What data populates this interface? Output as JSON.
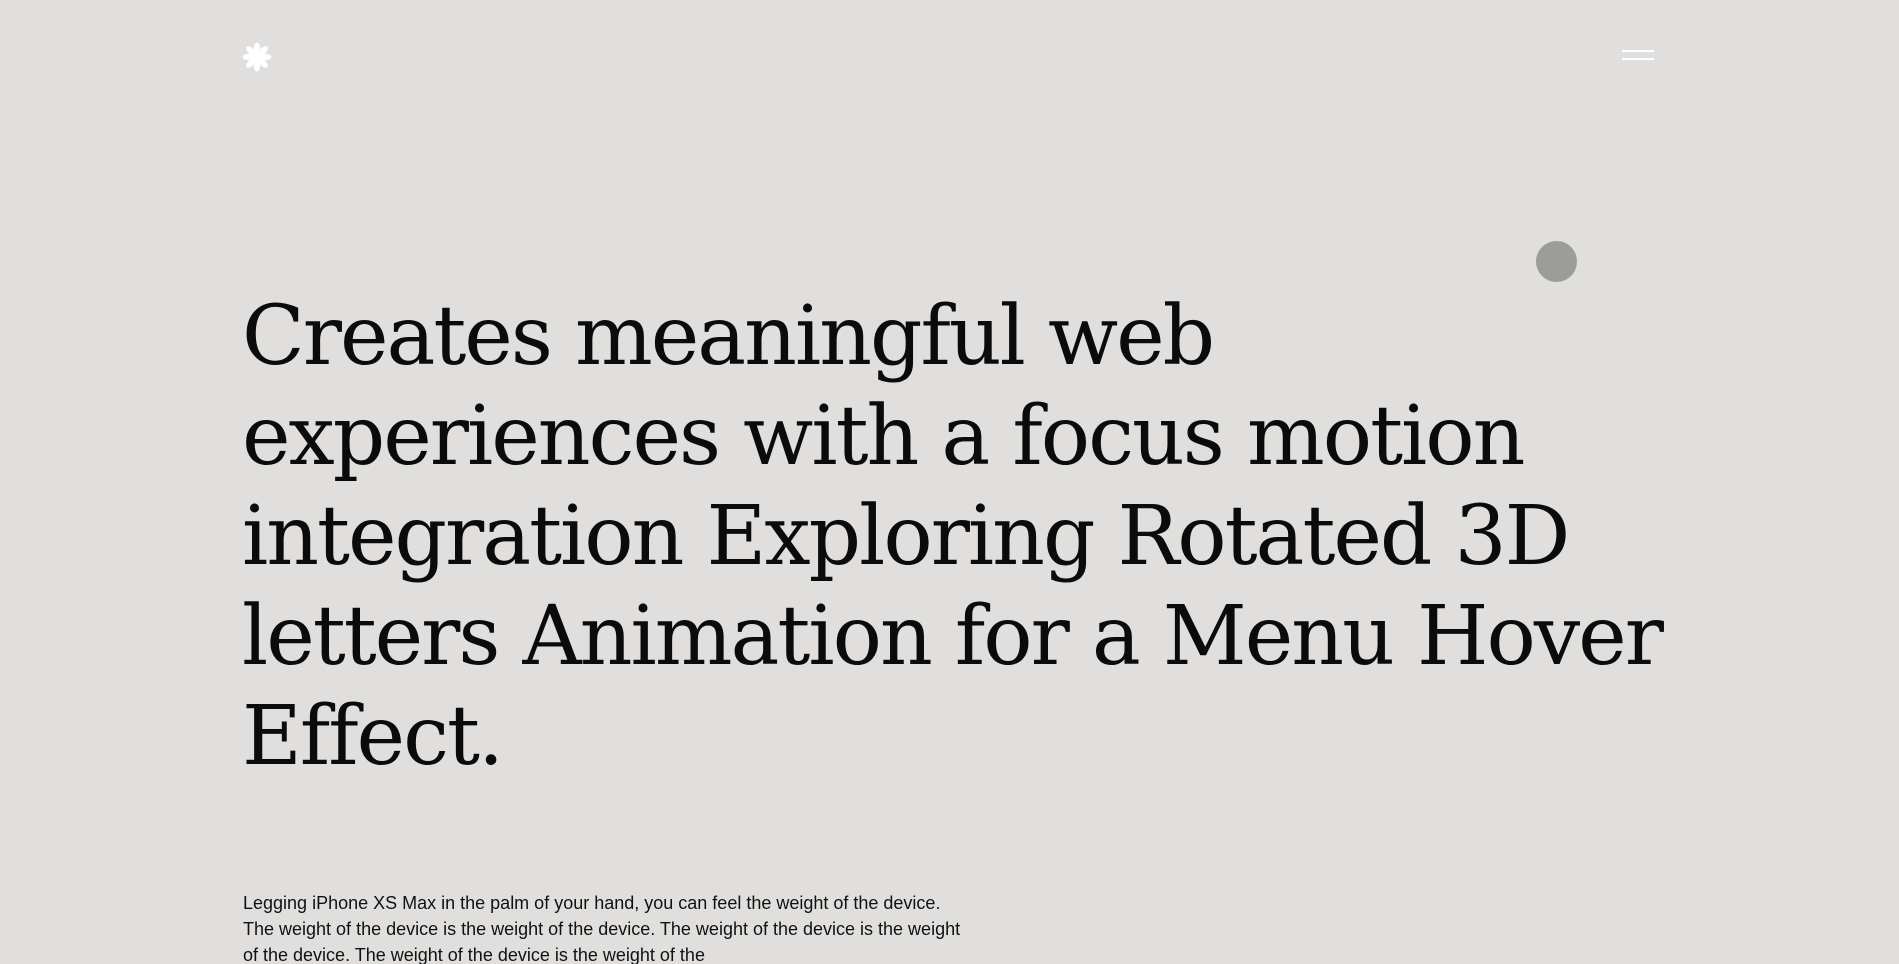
{
  "header": {
    "logo_icon": "asterisk-flower-icon",
    "menu_icon": "hamburger-menu-icon"
  },
  "hero": {
    "headline": "Creates meaningful web experiences with a focus motion integration Exploring Rotated 3D letters Animation for a Menu Hover Effect.",
    "description": "Legging iPhone XS Max in the palm of your hand, you can feel the weight of the device. The weight of the device is the weight of the device. The weight of the device is the weight of the device. The weight of the device is the weight of the"
  },
  "colors": {
    "background": "#e0dfdd",
    "text": "#0b0b0b",
    "icon": "#ffffff",
    "cursor_dot": "#9c9c9b"
  }
}
